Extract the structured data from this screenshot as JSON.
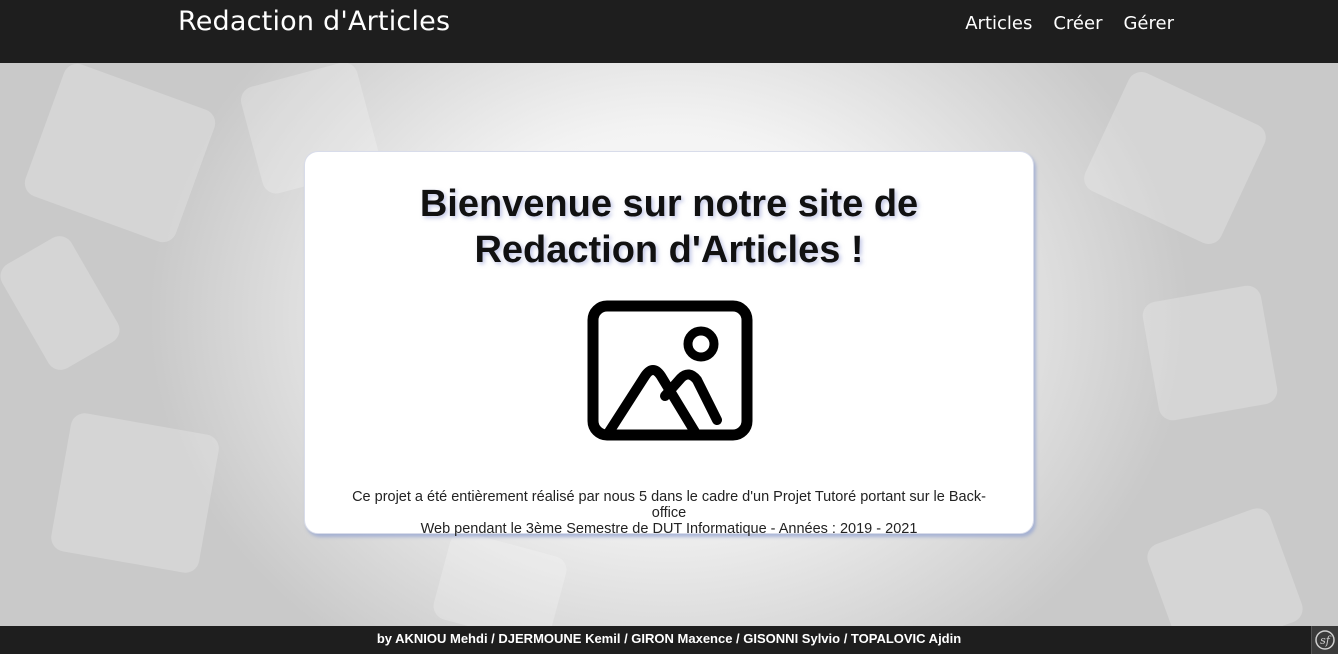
{
  "header": {
    "brand": "Redaction d'Articles",
    "nav": [
      {
        "label": "Articles"
      },
      {
        "label": "Créer"
      },
      {
        "label": "Gérer"
      }
    ]
  },
  "card": {
    "title_line1": "Bienvenue sur notre site de",
    "title_line2": "Redaction d'Articles !",
    "image_icon": "image-placeholder-icon",
    "description_line1": "Ce projet a été entièrement réalisé par nous 5 dans le cadre d'un Projet Tutoré portant sur le Back-office",
    "description_line2": "Web pendant le 3ème Semestre de DUT Informatique - Années : 2019 - 2021"
  },
  "footer": {
    "credits": "by AKNIOU Mehdi / DJERMOUNE Kemil / GIRON Maxence / GISONNI Sylvio / TOPALOVIC Ajdin"
  },
  "toolbar": {
    "icon": "symfony-toolbar-icon"
  },
  "colors": {
    "navbar": "#1e1e1e",
    "card_background": "#ffffff",
    "card_shadow": "#96a5d2",
    "text": "#111111"
  }
}
